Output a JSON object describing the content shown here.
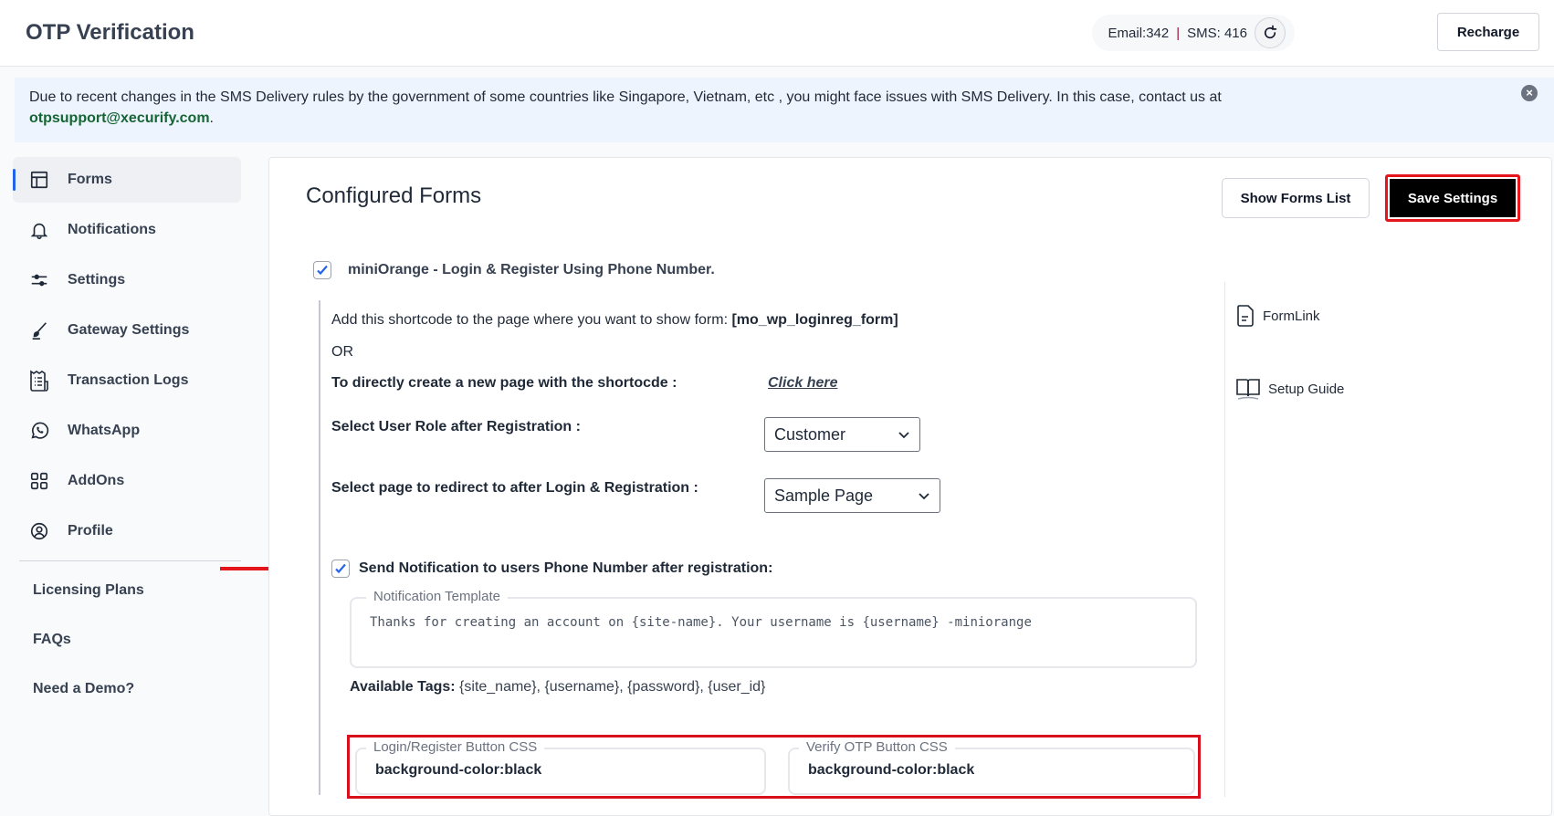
{
  "header": {
    "title": "OTP Verification",
    "credits": {
      "email_label": "Email:342",
      "separator": "|",
      "sms_label": "SMS: 416"
    },
    "recharge_label": "Recharge"
  },
  "banner": {
    "message": "Due to recent changes in the SMS Delivery rules by the government of some countries like Singapore, Vietnam, etc , you might face issues with SMS Delivery. In this case, contact us at ",
    "email": "otpsupport@xecurify.com",
    "suffix": "."
  },
  "sidebar": {
    "items": [
      {
        "label": "Forms",
        "icon": "layout-icon",
        "active": true
      },
      {
        "label": "Notifications",
        "icon": "bell-icon"
      },
      {
        "label": "Settings",
        "icon": "sliders-icon"
      },
      {
        "label": "Gateway Settings",
        "icon": "brush-icon"
      },
      {
        "label": "Transaction Logs",
        "icon": "receipt-icon"
      },
      {
        "label": "WhatsApp",
        "icon": "whatsapp-icon"
      },
      {
        "label": "AddOns",
        "icon": "grid-icon"
      },
      {
        "label": "Profile",
        "icon": "user-circle-icon"
      }
    ],
    "links": [
      "Licensing Plans",
      "FAQs",
      "Need a Demo?"
    ]
  },
  "main": {
    "title": "Configured Forms",
    "show_forms_label": "Show Forms List",
    "save_label": "Save Settings",
    "form": {
      "name": "miniOrange - Login & Register Using Phone Number.",
      "checked": true,
      "shortcode_text": "Add this shortcode to the page where you want to show form: ",
      "shortcode": "[mo_wp_loginreg_form]",
      "or_text": "OR",
      "create_page_text": "To directly create a new page with the shortocde :",
      "click_here": "Click here",
      "user_role_label": "Select User Role after Registration :",
      "user_role_value": "Customer",
      "redirect_label": "Select page to redirect to after Login & Registration :",
      "redirect_value": "Sample Page",
      "notification_label": "Send Notification to users Phone Number after registration:",
      "notification_checked": true,
      "template_legend": "Notification Template",
      "template_text": "Thanks for creating an account on {site-name}. Your username is {username} -miniorange",
      "tags_label": "Available Tags:",
      "tags_value": " {site_name}, {username}, {password}, {user_id}",
      "login_css_legend": "Login/Register Button CSS",
      "login_css_value": "background-color:black",
      "verify_css_legend": "Verify OTP Button CSS",
      "verify_css_value": "background-color:black"
    },
    "rail": {
      "formlink": "FormLink",
      "setup_guide": "Setup Guide"
    }
  },
  "colors": {
    "accent": "#2563eb",
    "highlight_red": "#e5161b",
    "email_green": "#166534"
  }
}
